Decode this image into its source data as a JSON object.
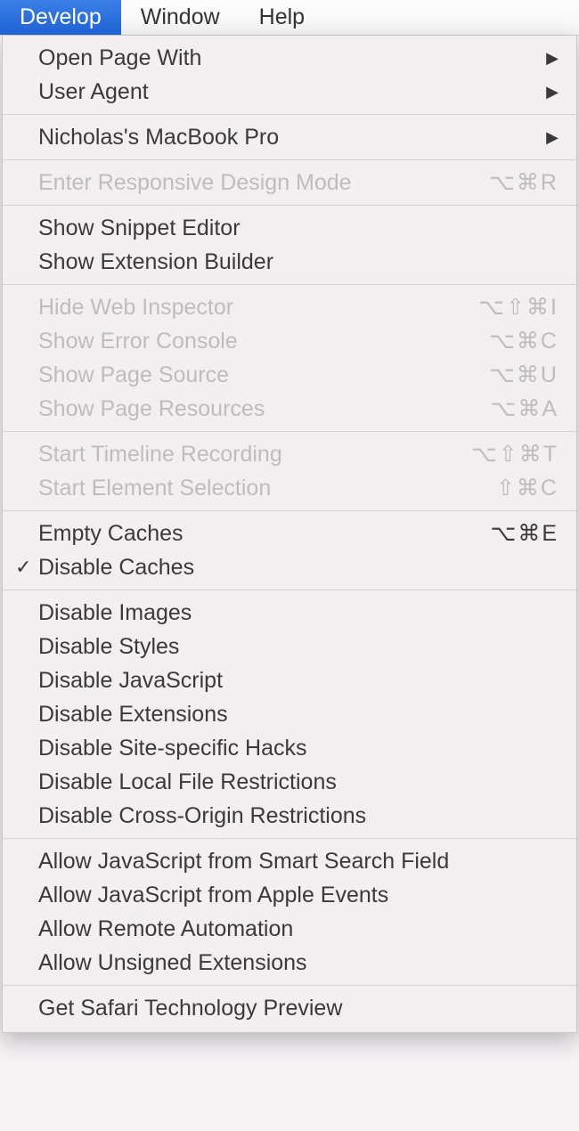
{
  "menubar": {
    "develop": "Develop",
    "window": "Window",
    "help": "Help"
  },
  "menu": {
    "open_page_with": "Open Page With",
    "user_agent": "User Agent",
    "device_name": "Nicholas's MacBook Pro",
    "enter_responsive": "Enter Responsive Design Mode",
    "enter_responsive_sc": "⌥⌘R",
    "show_snippet_editor": "Show Snippet Editor",
    "show_extension_builder": "Show Extension Builder",
    "hide_web_inspector": "Hide Web Inspector",
    "hide_web_inspector_sc": "⌥⇧⌘I",
    "show_error_console": "Show Error Console",
    "show_error_console_sc": "⌥⌘C",
    "show_page_source": "Show Page Source",
    "show_page_source_sc": "⌥⌘U",
    "show_page_resources": "Show Page Resources",
    "show_page_resources_sc": "⌥⌘A",
    "start_timeline": "Start Timeline Recording",
    "start_timeline_sc": "⌥⇧⌘T",
    "start_element_selection": "Start Element Selection",
    "start_element_selection_sc": "⇧⌘C",
    "empty_caches": "Empty Caches",
    "empty_caches_sc": "⌥⌘E",
    "disable_caches": "Disable Caches",
    "disable_images": "Disable Images",
    "disable_styles": "Disable Styles",
    "disable_javascript": "Disable JavaScript",
    "disable_extensions": "Disable Extensions",
    "disable_site_hacks": "Disable Site-specific Hacks",
    "disable_local_file": "Disable Local File Restrictions",
    "disable_cross_origin": "Disable Cross-Origin Restrictions",
    "allow_js_smart_search": "Allow JavaScript from Smart Search Field",
    "allow_js_apple_events": "Allow JavaScript from Apple Events",
    "allow_remote_automation": "Allow Remote Automation",
    "allow_unsigned_ext": "Allow Unsigned Extensions",
    "get_safari_tech_preview": "Get Safari Technology Preview"
  },
  "glyphs": {
    "check": "✓",
    "arrow": "▶"
  }
}
